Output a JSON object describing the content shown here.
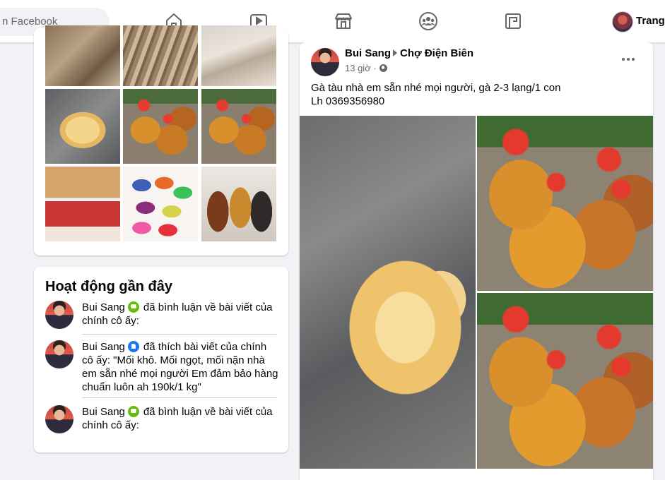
{
  "topbar": {
    "search_placeholder": "Tìm kiếm trên Facebook",
    "search_visible": "n Facebook",
    "nav": [
      "home-icon",
      "watch-icon",
      "marketplace-icon",
      "groups-icon",
      "gaming-icon"
    ],
    "profile_name": "Trang"
  },
  "photos": {
    "thumbnails": [
      "dried-fish",
      "dried-fish",
      "dried-fish",
      "chick",
      "roosters",
      "roosters",
      "slippers",
      "slippers",
      "slippers"
    ]
  },
  "activity": {
    "title": "Hoạt động gần đây",
    "items": [
      {
        "name": "Bui Sang",
        "badge": "comment",
        "text": "đã bình luận về bài viết của chính cô ấy:"
      },
      {
        "name": "Bui Sang",
        "badge": "like",
        "text": "đã thích bài viết của chính cô ấy: \"Mối khô. Mối ngọt, mối nặn nhà em sẵn nhé mọi người Em đảm bảo hàng chuẩn luôn ah 190k/1 kg\""
      },
      {
        "name": "Bui Sang",
        "badge": "comment",
        "text": "đã bình luận về bài viết của chính cô ấy:"
      }
    ]
  },
  "post": {
    "author": "Bui Sang",
    "group": "Chợ Điện Biên",
    "time": "13 giờ",
    "privacy_icon": "globe-icon",
    "text_line1": "Gà tàu nhà em sẵn nhé mọi người, gà 2-3 lạng/1 con",
    "text_line2": "Lh 0369356980"
  },
  "colors": {
    "background": "#f0f2f5",
    "card": "#ffffff",
    "secondary_text": "#65676b",
    "comment_badge": "#63be09",
    "like_badge": "#1877f2"
  }
}
